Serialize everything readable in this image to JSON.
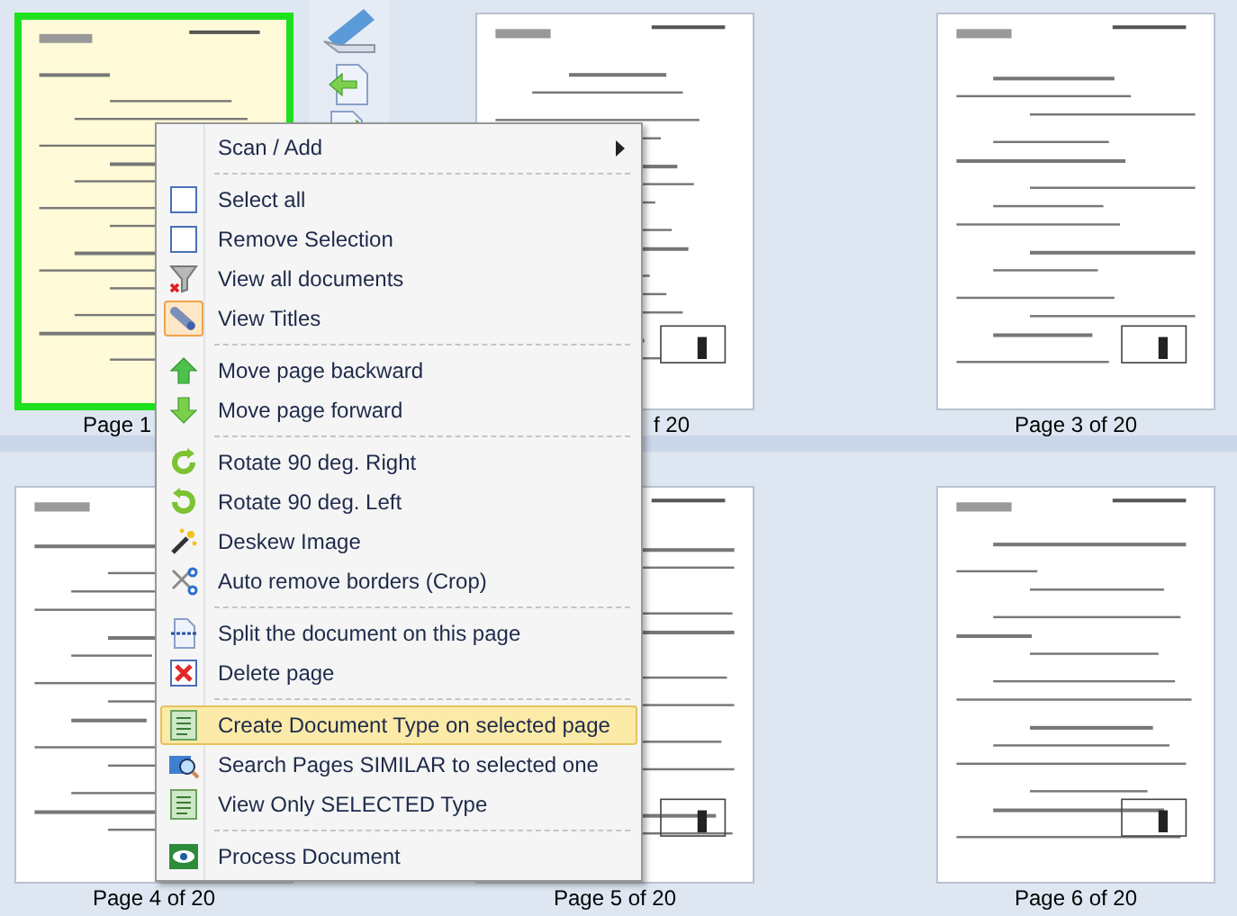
{
  "pages": [
    {
      "label": "Page 1",
      "selected": true
    },
    {
      "label": "f 20",
      "selected": false
    },
    {
      "label": "Page 3 of 20",
      "selected": false
    },
    {
      "label": "Page 4 of 20",
      "selected": false
    },
    {
      "label": "Page 5 of 20",
      "selected": false
    },
    {
      "label": "Page 6 of 20",
      "selected": false
    }
  ],
  "context_menu": {
    "items": [
      {
        "kind": "item",
        "label": "Scan / Add",
        "submenu": true,
        "selected": false,
        "checked": false
      },
      {
        "kind": "separator"
      },
      {
        "kind": "item",
        "label": "Select all",
        "submenu": false,
        "selected": false,
        "checked": false
      },
      {
        "kind": "item",
        "label": "Remove Selection",
        "submenu": false,
        "selected": false,
        "checked": false
      },
      {
        "kind": "item",
        "label": "View all documents",
        "submenu": false,
        "selected": false,
        "checked": false
      },
      {
        "kind": "item",
        "label": "View Titles",
        "submenu": false,
        "selected": false,
        "checked": true
      },
      {
        "kind": "separator"
      },
      {
        "kind": "item",
        "label": "Move page backward",
        "submenu": false,
        "selected": false,
        "checked": false
      },
      {
        "kind": "item",
        "label": "Move page forward",
        "submenu": false,
        "selected": false,
        "checked": false
      },
      {
        "kind": "separator"
      },
      {
        "kind": "item",
        "label": "Rotate 90 deg. Right",
        "submenu": false,
        "selected": false,
        "checked": false
      },
      {
        "kind": "item",
        "label": "Rotate 90 deg. Left",
        "submenu": false,
        "selected": false,
        "checked": false
      },
      {
        "kind": "item",
        "label": "Deskew Image",
        "submenu": false,
        "selected": false,
        "checked": false
      },
      {
        "kind": "item",
        "label": "Auto remove borders (Crop)",
        "submenu": false,
        "selected": false,
        "checked": false
      },
      {
        "kind": "separator"
      },
      {
        "kind": "item",
        "label": "Split the document on this page",
        "submenu": false,
        "selected": false,
        "checked": false
      },
      {
        "kind": "item",
        "label": "Delete page",
        "submenu": false,
        "selected": false,
        "checked": false
      },
      {
        "kind": "separator"
      },
      {
        "kind": "item",
        "label": "Create Document Type on selected page",
        "submenu": false,
        "selected": true,
        "checked": false
      },
      {
        "kind": "item",
        "label": "Search Pages SIMILAR to selected one",
        "submenu": false,
        "selected": false,
        "checked": false
      },
      {
        "kind": "item",
        "label": "View Only SELECTED Type",
        "submenu": false,
        "selected": false,
        "checked": false
      },
      {
        "kind": "separator"
      },
      {
        "kind": "item",
        "label": "Process Document",
        "submenu": false,
        "selected": false,
        "checked": false
      }
    ]
  }
}
